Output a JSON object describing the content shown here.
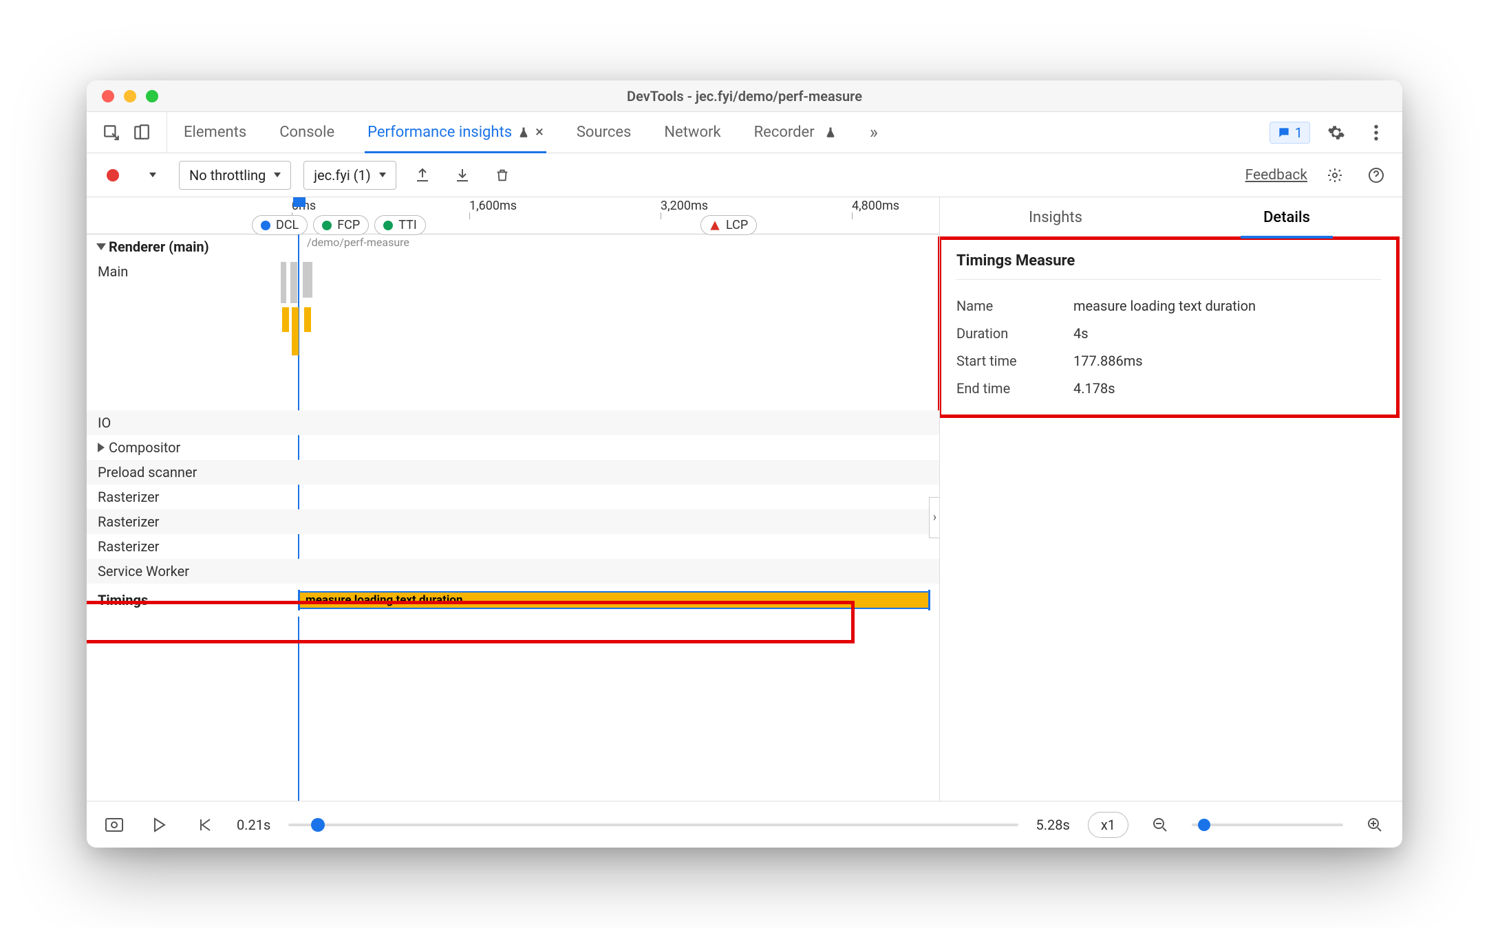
{
  "window": {
    "title": "DevTools - jec.fyi/demo/perf-measure"
  },
  "tabs": {
    "elements": "Elements",
    "console": "Console",
    "perf_insights": "Performance insights",
    "sources": "Sources",
    "network": "Network",
    "recorder": "Recorder"
  },
  "issue_count": "1",
  "toolbar": {
    "throttling": "No throttling",
    "recording_label": "jec.fyi (1)",
    "feedback": "Feedback"
  },
  "ruler": {
    "t0": "0ms",
    "t1": "1,600ms",
    "t2": "3,200ms",
    "t3": "4,800ms"
  },
  "markers": {
    "dcl": "DCL",
    "fcp": "FCP",
    "tti": "TTI",
    "lcp": "LCP"
  },
  "tracks": {
    "renderer": "Renderer (main)",
    "main": "Main",
    "io": "IO",
    "compositor": "Compositor",
    "preload": "Preload scanner",
    "rasterizer": "Rasterizer",
    "service_worker": "Service Worker",
    "timings": "Timings"
  },
  "url_fragment": "/demo/perf-measure",
  "timings_measure_label": "measure loading text duration",
  "details": {
    "tabs": {
      "insights": "Insights",
      "details": "Details"
    },
    "title": "Timings Measure",
    "rows": {
      "name_k": "Name",
      "name_v": "measure loading text duration",
      "duration_k": "Duration",
      "duration_v": "4s",
      "start_k": "Start time",
      "start_v": "177.886ms",
      "end_k": "End time",
      "end_v": "4.178s"
    }
  },
  "transport": {
    "start": "0.21s",
    "end": "5.28s",
    "speed": "x1"
  }
}
